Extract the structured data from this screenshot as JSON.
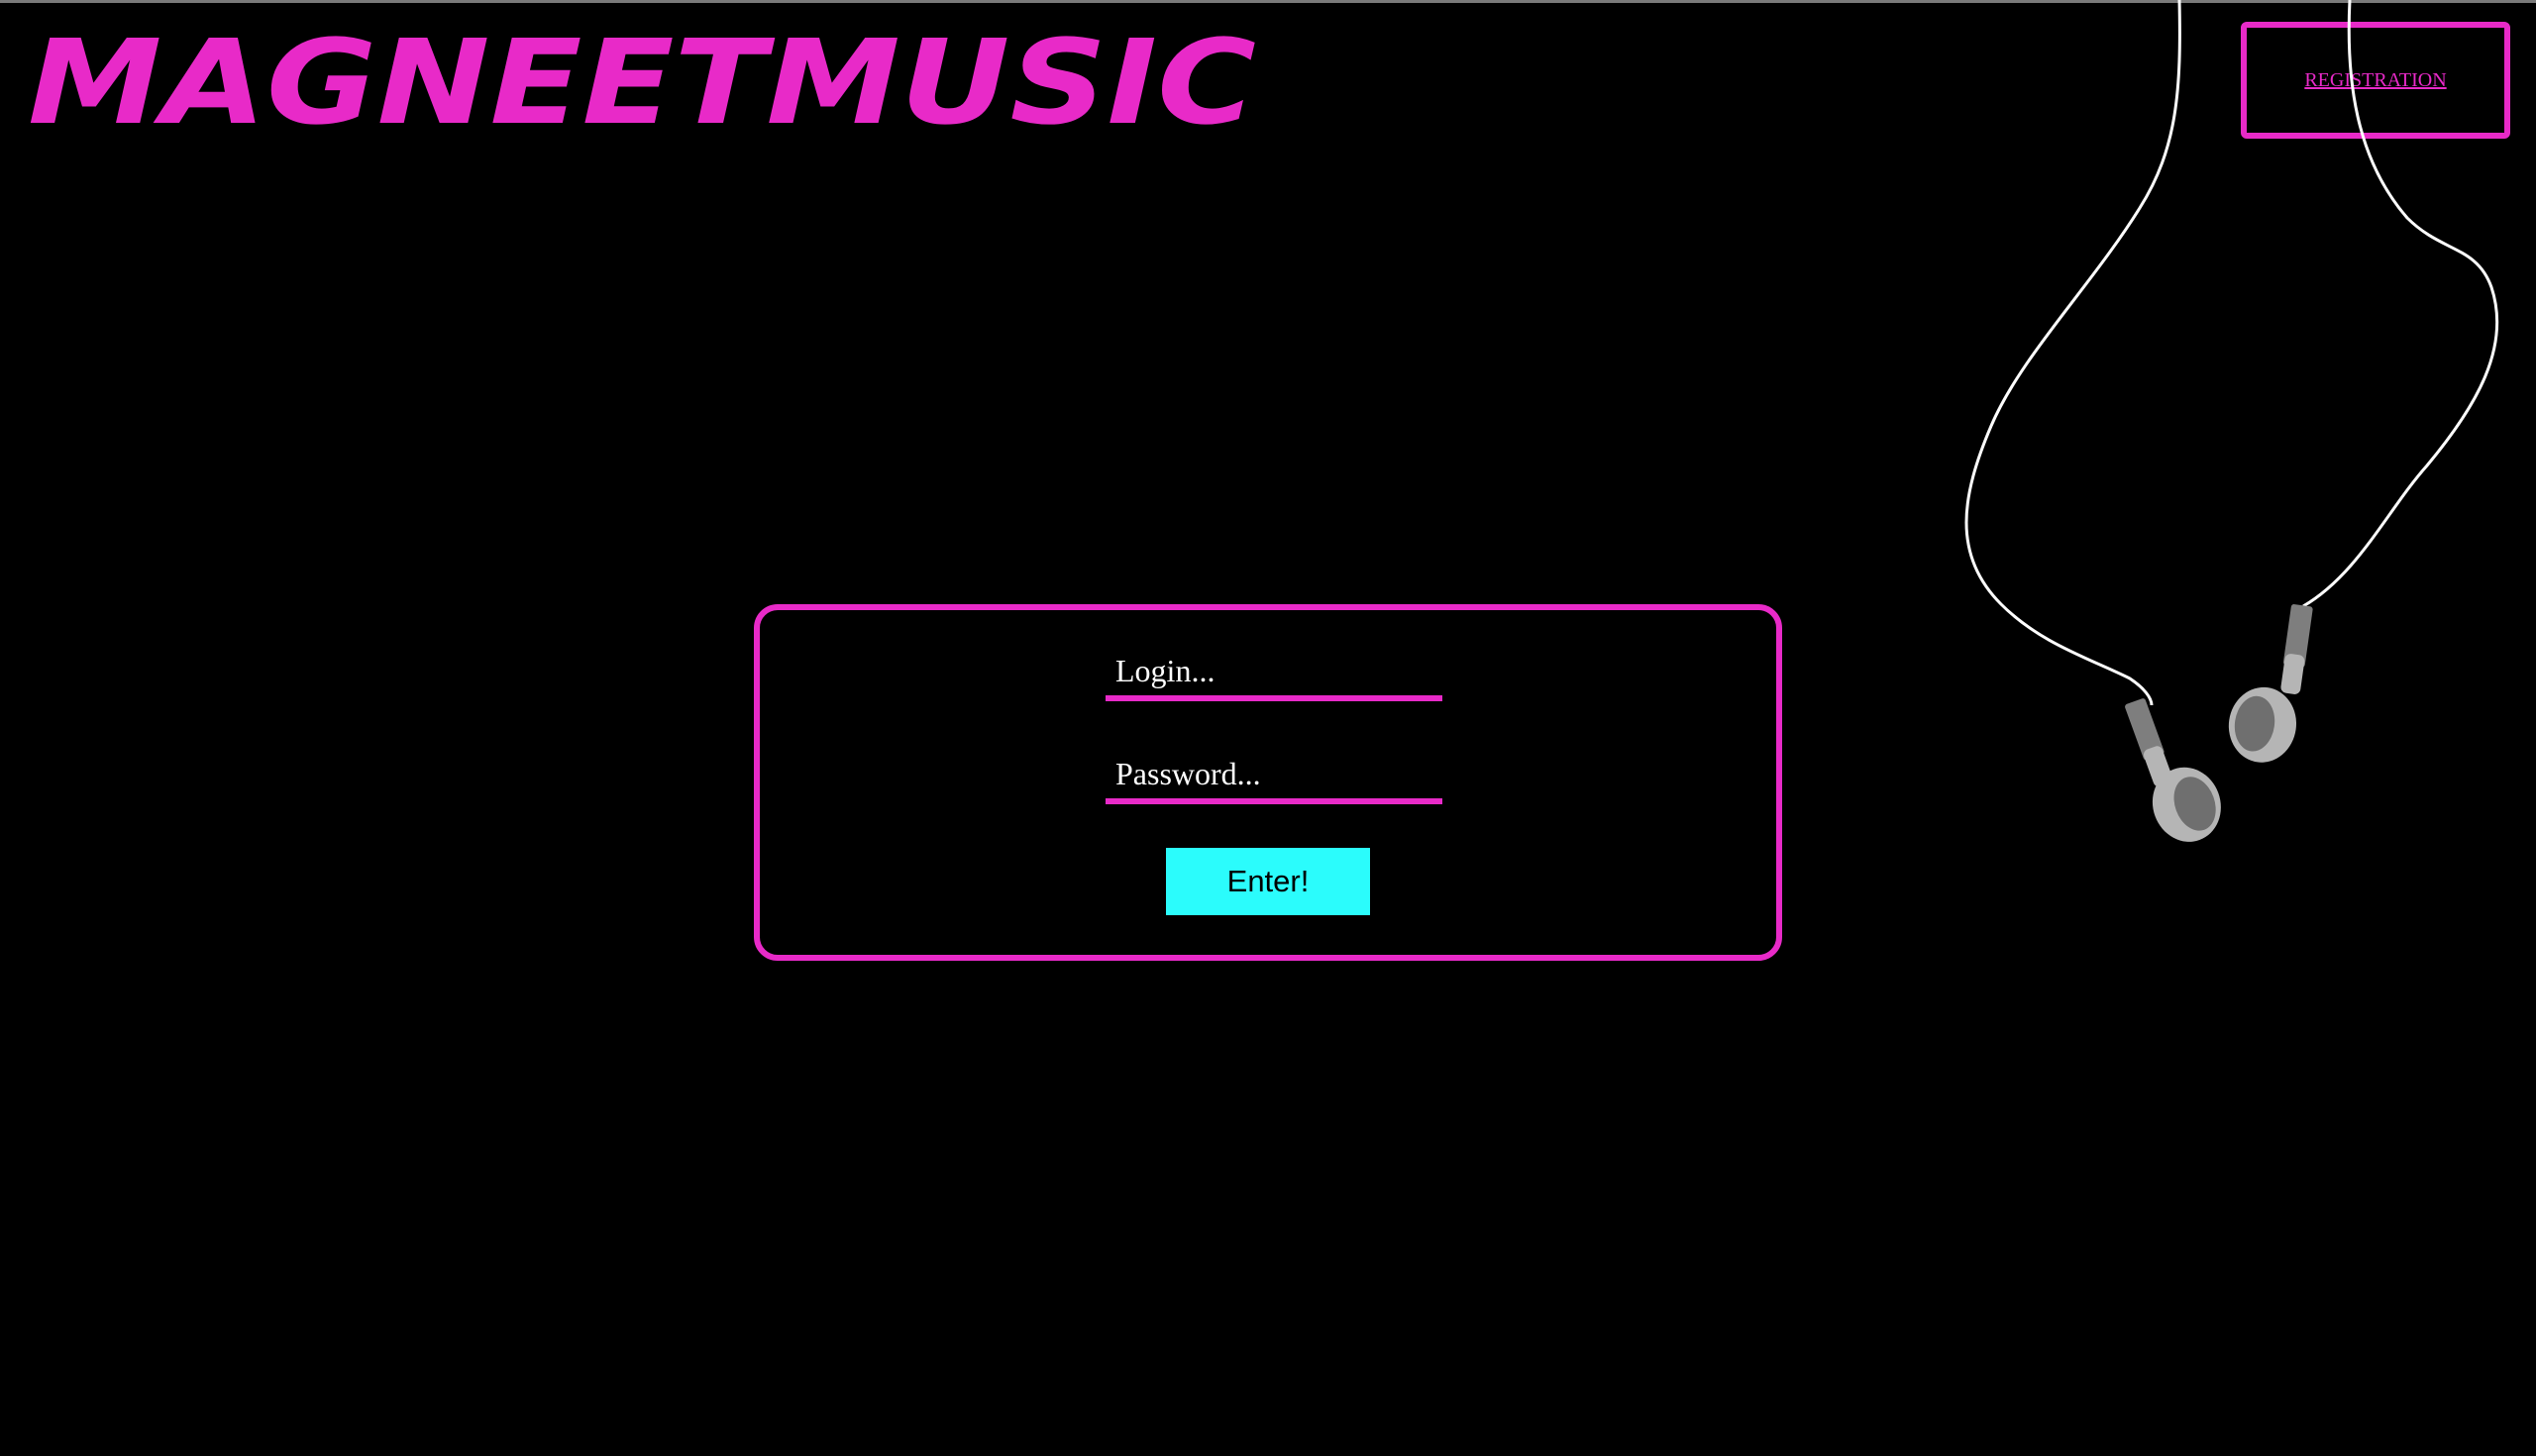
{
  "header": {
    "logo_text": "MAGNEETMUSIC",
    "registration_label": "REGISTRATION"
  },
  "login_form": {
    "login_placeholder": "Login...",
    "password_placeholder": "Password...",
    "submit_label": "Enter!"
  },
  "decor": {
    "earphones_icon": "earphones-icon"
  },
  "colors": {
    "background": "#000000",
    "accent_magenta": "#e82ac8",
    "button_cyan": "#2bfcfc",
    "earphone_gray": "#b5b5b5"
  }
}
